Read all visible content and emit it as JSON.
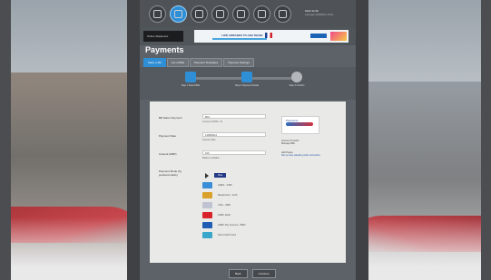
{
  "header": {
    "nav_icons": [
      "home-icon",
      "payments-icon",
      "transfer-icon",
      "bills-icon",
      "cards-icon",
      "statements-icon",
      "settings-icon"
    ],
    "active_index": 1,
    "user_name": "Mark Smith",
    "user_sub": "Last login 14/08/2014 10:32"
  },
  "banner": {
    "left_label": "Online Statement",
    "ad_text": "LOW AIRFARES TO ABU DHABI",
    "ad_button": "Book now"
  },
  "page": {
    "title": "Payments"
  },
  "tabs": [
    {
      "label": "Make a Bill"
    },
    {
      "label": "List of Bills"
    },
    {
      "label": "Payment Templates"
    },
    {
      "label": "Payment Settings"
    }
  ],
  "steps": [
    {
      "label": "Step 1 Select Bills"
    },
    {
      "label": "Step 2 Payment Details"
    },
    {
      "label": "Step 3 Confirm"
    }
  ],
  "form": {
    "fields": [
      {
        "label": "Bill Name Payment",
        "value": "Bill 1",
        "note": "Account 123456 - 01"
      },
      {
        "label": "Payment Date",
        "value": "14/08/2014",
        "note": "Selected date"
      },
      {
        "label": "Amount (GBP)",
        "value": "150",
        "note": "Balance available"
      }
    ],
    "payment_label": "Payment Mode (by postcard cards)",
    "payment_methods": [
      {
        "name": "Visa",
        "color": "#1a3d8f",
        "selected": true
      },
      {
        "name": "AMEX - 4468",
        "color": "#3a8fd8",
        "selected": false
      },
      {
        "name": "MasterCard - 1125",
        "color": "#d9a02a",
        "selected": false
      },
      {
        "name": "VISA - 3380",
        "color": "#c0c4d2",
        "selected": false
      },
      {
        "name": "HSBC Debit",
        "color": "#d8232a",
        "selected": false
      },
      {
        "name": "HSBC Pay Account - 8890",
        "color": "#1f5cb3",
        "selected": false
      },
      {
        "name": "Direct Debit Card",
        "color": "#3aa6c9",
        "selected": false
      }
    ]
  },
  "side": {
    "logo_text": "Payments",
    "line1": "Account Transfer",
    "line2": "Manage Bills",
    "line3": "Add Payee",
    "link": "Set up new standing order instruction"
  },
  "footer": {
    "back_label": "Back",
    "next_label": "Continue"
  }
}
